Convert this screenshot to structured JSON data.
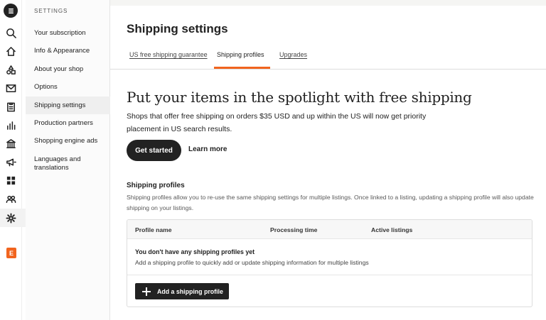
{
  "rail": {
    "icons": [
      "shop-logo-icon",
      "search-icon",
      "home-icon",
      "listings-icon",
      "messages-icon",
      "orders-icon",
      "stats-icon",
      "finances-icon",
      "marketing-icon",
      "integrations-icon",
      "community-icon",
      "settings-icon"
    ],
    "shop_badge": "E",
    "brand_color": "#f1641e"
  },
  "settings_nav": {
    "header": "SETTINGS",
    "items": [
      {
        "label": "Your subscription"
      },
      {
        "label": "Info & Appearance"
      },
      {
        "label": "About your shop"
      },
      {
        "label": "Options"
      },
      {
        "label": "Shipping settings",
        "active": true
      },
      {
        "label": "Production partners"
      },
      {
        "label": "Shopping engine ads"
      },
      {
        "label": "Languages and translations"
      }
    ]
  },
  "page": {
    "title": "Shipping settings",
    "tabs": [
      {
        "label": "US free shipping guarantee"
      },
      {
        "label": "Shipping profiles",
        "active": true
      },
      {
        "label": "Upgrades"
      }
    ]
  },
  "promo": {
    "heading": "Put your items in the spotlight with free shipping",
    "text": "Shops that offer free shipping on orders $35 USD and up within the US will now get priority placement in US search results.",
    "primary_button": "Get started",
    "secondary_button": "Learn more"
  },
  "profiles": {
    "title": "Shipping profiles",
    "description": "Shipping profiles allow you to re-use the same shipping settings for multiple listings. Once linked to a listing, updating a shipping profile will also update shipping on your listings.",
    "columns": [
      "Profile name",
      "Processing time",
      "Active listings"
    ],
    "empty_title": "You don't have any shipping profiles yet",
    "empty_text": "Add a shipping profile to quickly add or update shipping information for multiple listings",
    "add_button": "Add a shipping profile"
  }
}
